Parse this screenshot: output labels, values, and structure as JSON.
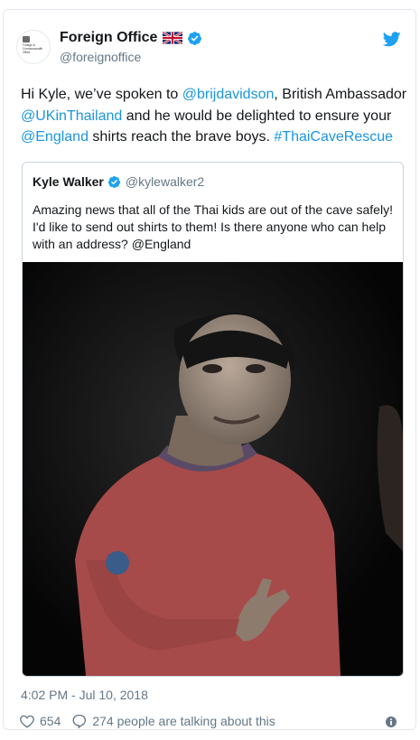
{
  "tweet": {
    "author": {
      "display_name": "Foreign Office",
      "handle": "@foreignoffice",
      "avatar_text": [
        "Foreign &",
        "Commonwealth",
        "Office"
      ]
    },
    "text_parts": [
      {
        "text": "Hi Kyle, we’ve spoken to ",
        "type": "plain"
      },
      {
        "text": "@brijdavidson",
        "type": "link"
      },
      {
        "text": ", British Ambassador ",
        "type": "plain"
      },
      {
        "text": "@UKinThailand",
        "type": "link"
      },
      {
        "text": " and he would be delighted to ensure your ",
        "type": "plain"
      },
      {
        "text": "@England",
        "type": "link"
      },
      {
        "text": " shirts reach the brave boys. ",
        "type": "plain"
      },
      {
        "text": "#ThaiCaveRescue",
        "type": "link"
      }
    ],
    "quoted": {
      "display_name": "Kyle Walker",
      "handle": "@kylewalker2",
      "text": "Amazing news that all of the Thai kids are out of the cave safely! I'd like to send out shirts to them! Is there anyone who can help with an address? @England",
      "media": "photo-of-boy-in-cave"
    },
    "timestamp": "4:02 PM - Jul 10, 2018",
    "likes": "654",
    "talking": "274 people are talking about this"
  },
  "colors": {
    "link": "#1b95e0",
    "verified": "#1da1f2",
    "muted": "#657786",
    "border": "#e1e8ed"
  },
  "icons": {
    "brand": "twitter-bird-icon",
    "verified": "verified-badge-icon",
    "flag": "uk-flag-icon",
    "like": "heart-icon",
    "reply": "speech-bubble-icon",
    "info": "info-icon"
  }
}
